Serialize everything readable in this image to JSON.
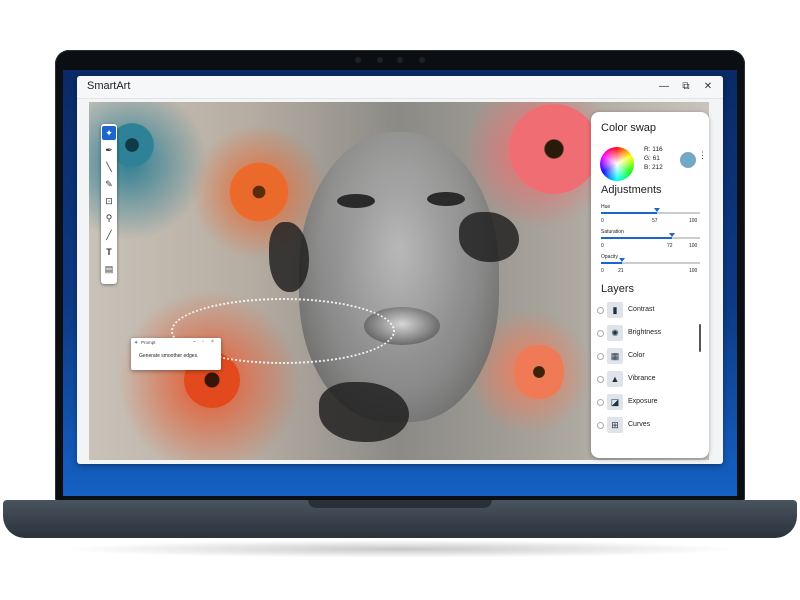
{
  "app": {
    "title": "SmartArt"
  },
  "window_controls": {
    "minimize": "—",
    "restore": "⧉",
    "close": "✕"
  },
  "prompt": {
    "title": "Prompt",
    "text": "Generate smoother edges."
  },
  "color_swap": {
    "title": "Color swap",
    "r": "R: 116",
    "g": "G: 61",
    "b": "B: 212",
    "swatch_color": "#74a8c4"
  },
  "adjustments": {
    "title": "Adjustments",
    "sliders": [
      {
        "label": "Hue",
        "min": "0",
        "value": "57",
        "max": "100",
        "fraction": 0.57
      },
      {
        "label": "Saturation",
        "min": "0",
        "value": "72",
        "max": "100",
        "fraction": 0.72
      },
      {
        "label": "Opacity",
        "min": "0",
        "value": "21",
        "max": "100",
        "fraction": 0.21
      }
    ]
  },
  "layers": {
    "title": "Layers",
    "items": [
      {
        "label": "Contrast",
        "icon": "contrast-icon"
      },
      {
        "label": "Brightness",
        "icon": "brightness-icon"
      },
      {
        "label": "Color",
        "icon": "color-icon"
      },
      {
        "label": "Vibrance",
        "icon": "vibrance-icon"
      },
      {
        "label": "Exposure",
        "icon": "exposure-icon"
      },
      {
        "label": "Curves",
        "icon": "curves-icon"
      }
    ]
  },
  "tools": [
    "magic-wand-icon",
    "pen-icon",
    "brush-icon",
    "pencil-icon",
    "crop-icon",
    "zoom-icon",
    "dropper-icon",
    "text-icon",
    "layers-icon"
  ],
  "colors": {
    "accent": "#1a66cc"
  }
}
